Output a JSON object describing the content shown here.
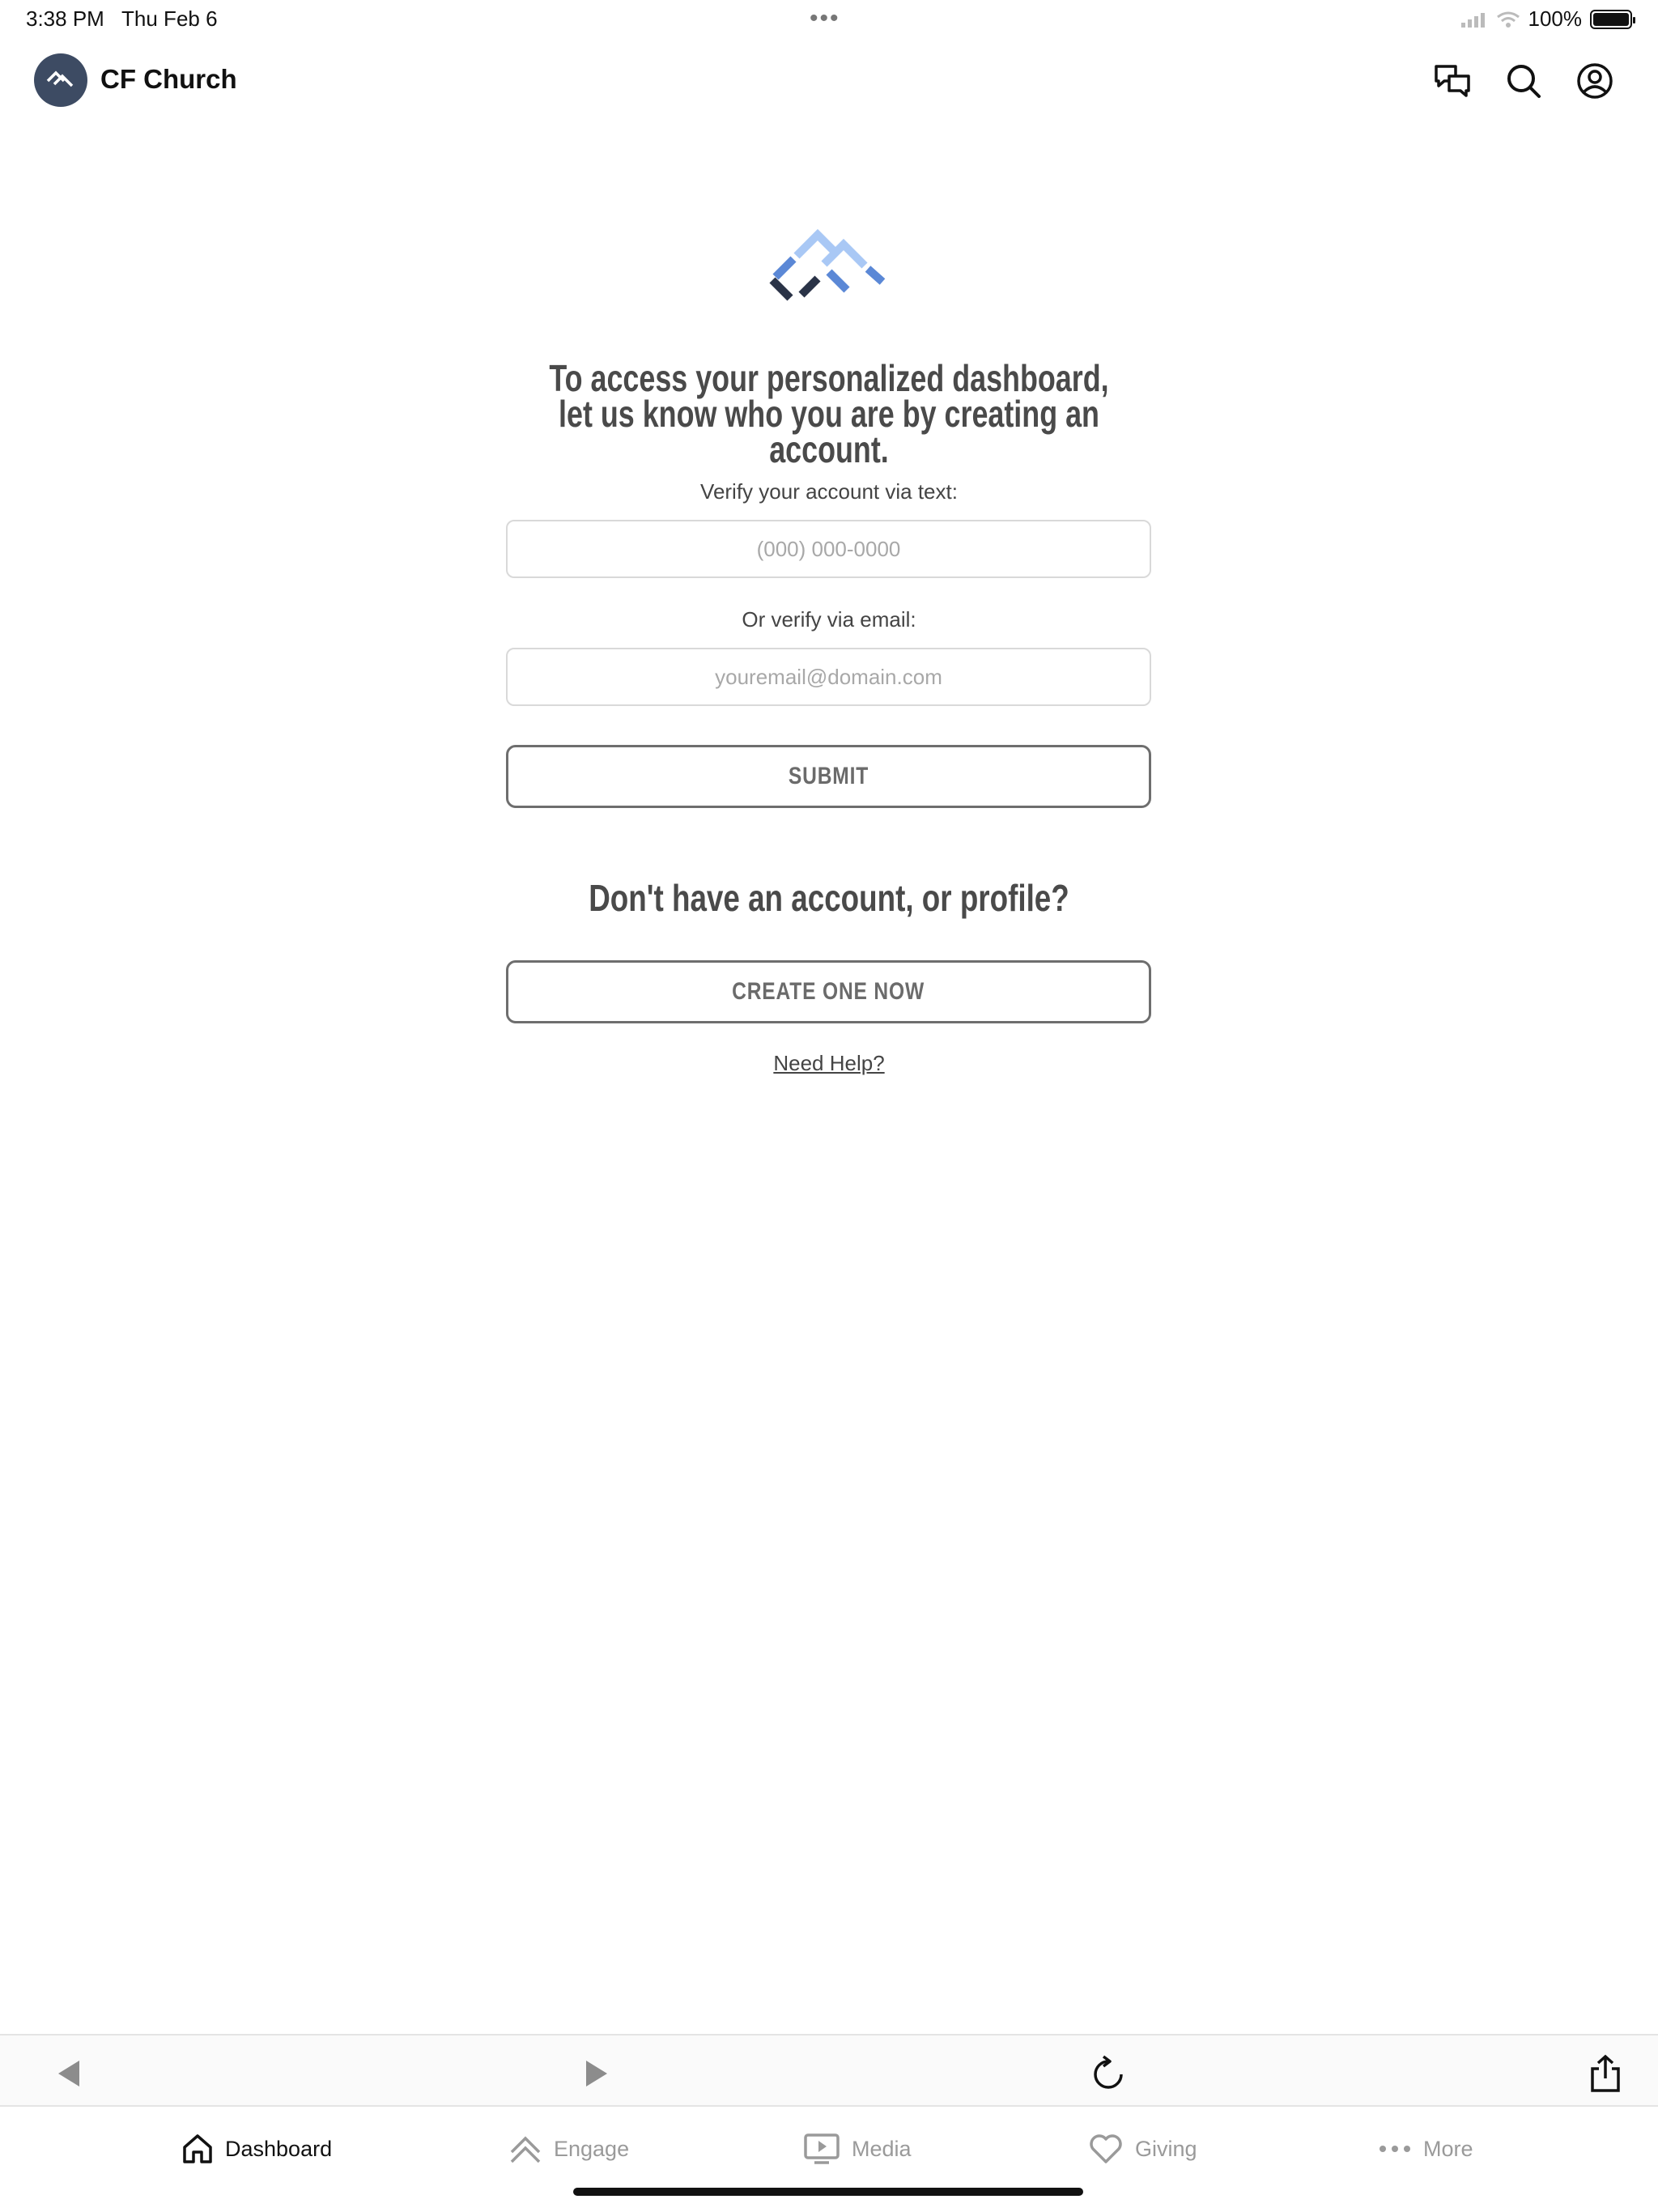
{
  "status_bar": {
    "time": "3:38 PM",
    "date": "Thu Feb 6",
    "battery": "100%",
    "battery_level": 1.0
  },
  "header": {
    "app_name": "CF Church",
    "icons": [
      "chat-icon",
      "search-icon",
      "account-icon"
    ]
  },
  "main": {
    "headline": "To access your personalized dashboard, let us know who you are by creating an account.",
    "phone": {
      "label": "Verify your account via text:",
      "placeholder": "(000) 000-0000",
      "value": ""
    },
    "email": {
      "label": "Or verify via email:",
      "placeholder": "youremail@domain.com",
      "value": ""
    },
    "submit_label": "SUBMIT",
    "no_account_heading": "Don't have an account, or profile?",
    "create_label": "CREATE ONE NOW",
    "help_label": "Need Help?"
  },
  "browser_toolbar": {
    "icons": [
      "back-icon",
      "forward-icon",
      "reload-icon",
      "share-icon"
    ]
  },
  "tabs": [
    {
      "label": "Dashboard",
      "icon": "home-icon",
      "active": true
    },
    {
      "label": "Engage",
      "icon": "engage-icon",
      "active": false
    },
    {
      "label": "Media",
      "icon": "media-icon",
      "active": false
    },
    {
      "label": "Giving",
      "icon": "heart-icon",
      "active": false
    },
    {
      "label": "More",
      "icon": "more-icon",
      "active": false
    }
  ],
  "colors": {
    "brand_navy": "#3d4b63",
    "logo_dark": "#2a3347",
    "logo_mid": "#5b88d6",
    "logo_light": "#a9c8f5",
    "heading_gray": "#4a4a4a",
    "button_border": "#6e6e6e"
  }
}
